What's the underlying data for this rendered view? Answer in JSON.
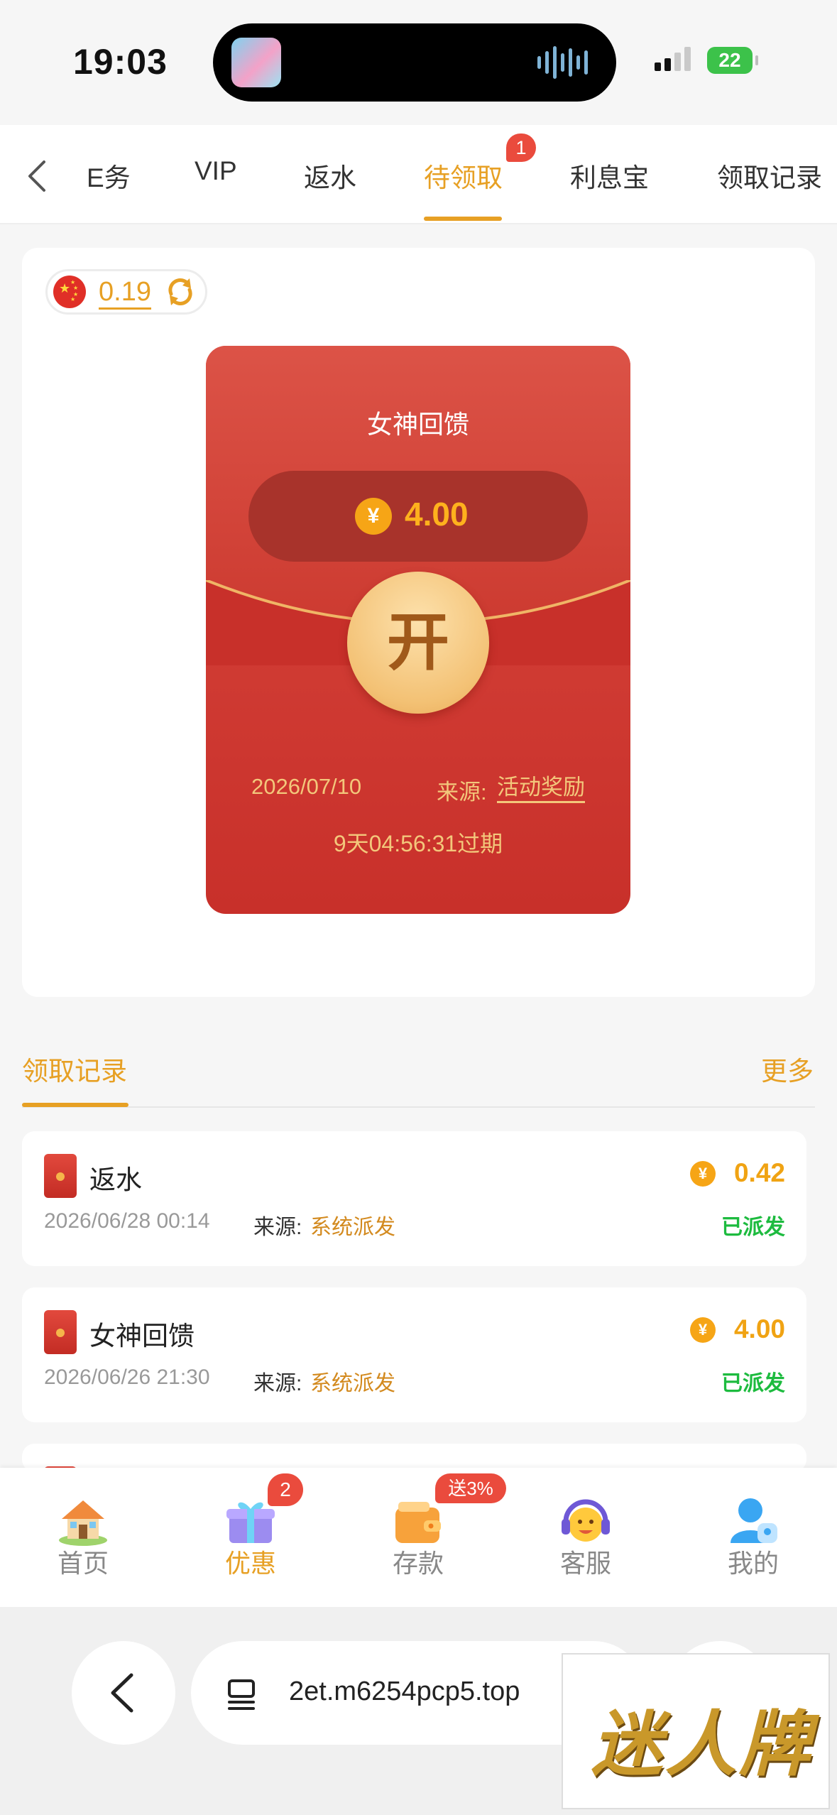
{
  "status_bar": {
    "time": "19:03",
    "battery": "22"
  },
  "tabs": {
    "items": [
      {
        "label": "任务",
        "shown": "E务"
      },
      {
        "label": "VIP",
        "shown": "VIP"
      },
      {
        "label": "返水",
        "shown": "返水"
      },
      {
        "label": "待领取",
        "shown": "待领取"
      },
      {
        "label": "利息宝",
        "shown": "利息宝"
      },
      {
        "label": "领取记录",
        "shown": "领取记录"
      }
    ],
    "active_index": 3,
    "badge": "1"
  },
  "balance": {
    "value": "0.19"
  },
  "red_envelope": {
    "title": "女神回馈",
    "currency_symbol": "¥",
    "amount": "4.00",
    "open_label": "开",
    "date": "2026/07/10",
    "source_label": "来源:",
    "source": "活动奖励",
    "expire": "9天04:56:31过期"
  },
  "records": {
    "title": "领取记录",
    "more": "更多",
    "items": [
      {
        "title": "返水",
        "datetime": "2026/06/28 00:14",
        "source_label": "来源:",
        "source": "系统派发",
        "currency_symbol": "¥",
        "amount": "0.42",
        "status": "已派发"
      },
      {
        "title": "女神回馈",
        "datetime": "2026/06/26 21:30",
        "source_label": "来源:",
        "source": "系统派发",
        "currency_symbol": "¥",
        "amount": "4.00",
        "status": "已派发"
      }
    ]
  },
  "bottom_nav": {
    "items": [
      {
        "label": "首页",
        "icon": "home-icon"
      },
      {
        "label": "优惠",
        "icon": "gift-icon",
        "badge": "2"
      },
      {
        "label": "存款",
        "icon": "wallet-icon",
        "badge": "送3%"
      },
      {
        "label": "客服",
        "icon": "support-icon"
      },
      {
        "label": "我的",
        "icon": "user-icon"
      }
    ],
    "active_index": 1
  },
  "browser": {
    "url": "2et.m6254pcp5.top"
  },
  "watermark": {
    "text": "迷人牌"
  },
  "colors": {
    "accent": "#e7a024",
    "envelope_red": "#c8302a",
    "success_green": "#1dbb3f",
    "badge_red": "#ea4b3d"
  }
}
